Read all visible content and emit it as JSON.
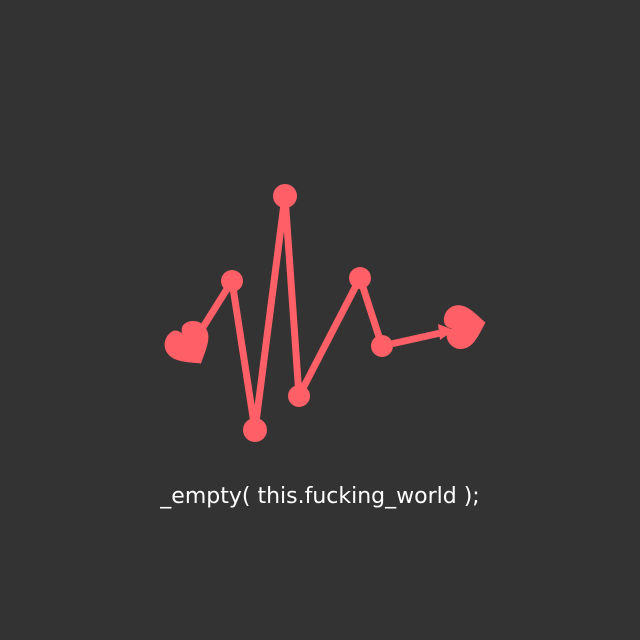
{
  "caption": "_empty( this.fucking_world );",
  "colors": {
    "background": "#333333",
    "accent": "#ff5f66",
    "text": "#ffffff"
  },
  "icons": [
    "heartbeat-line-icon",
    "heart-tail-icon",
    "heart-arrowhead-icon"
  ]
}
